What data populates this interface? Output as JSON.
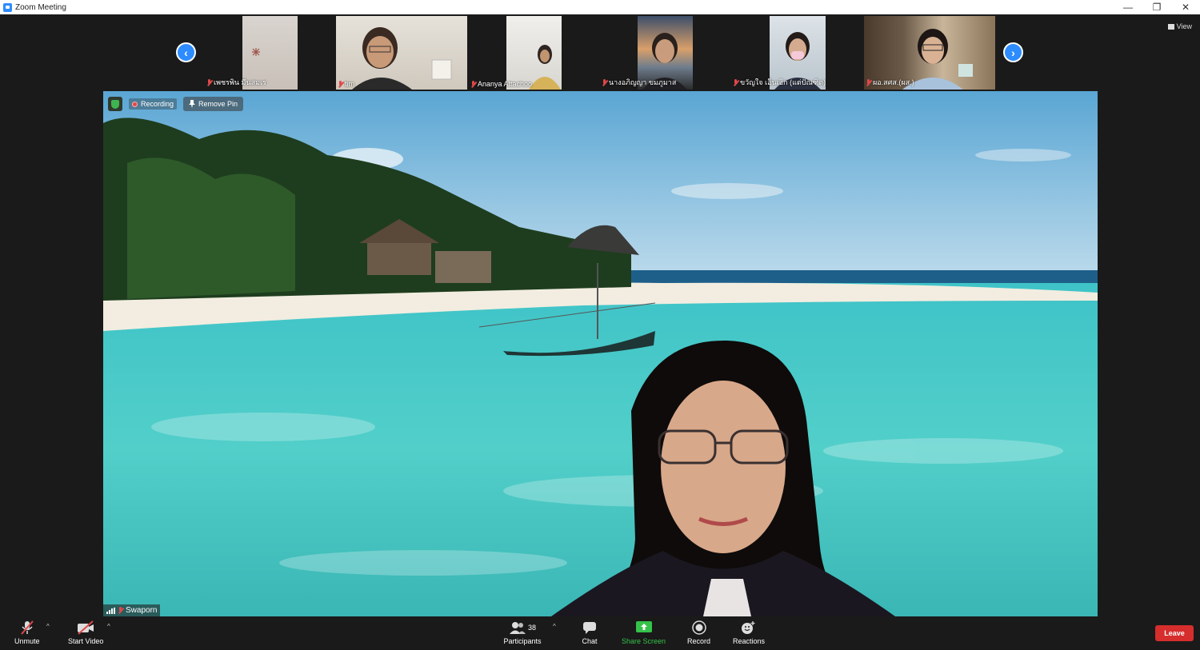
{
  "window": {
    "title": "Zoom Meeting",
    "controls": [
      "—",
      "❐",
      "✕"
    ]
  },
  "gallery": {
    "prev_icon": "‹",
    "next_icon": "›",
    "view_label": "View",
    "participants": [
      {
        "name": "เพชรพิน มีนสมเร"
      },
      {
        "name": "tim"
      },
      {
        "name": "Ananya Attachoo"
      },
      {
        "name": "นางอภิญญา ขมภูมาส"
      },
      {
        "name": "ขวัญใจ เอ็นเอิก (แต่ปัณฑิต)"
      },
      {
        "name": "ผอ.สศส.(ผส.)"
      }
    ]
  },
  "main_video": {
    "recording_label": "Recording",
    "remove_pin_label": "Remove Pin",
    "speaker_name": "Swaporn"
  },
  "toolbar": {
    "unmute": "Unmute",
    "start_video": "Start Video",
    "participants": "Participants",
    "participants_count": "38",
    "chat": "Chat",
    "share_screen": "Share Screen",
    "record": "Record",
    "reactions": "Reactions",
    "leave": "Leave"
  },
  "colors": {
    "accent": "#2d8cff",
    "share_green": "#35c24a",
    "leave_red": "#d62d2d"
  }
}
